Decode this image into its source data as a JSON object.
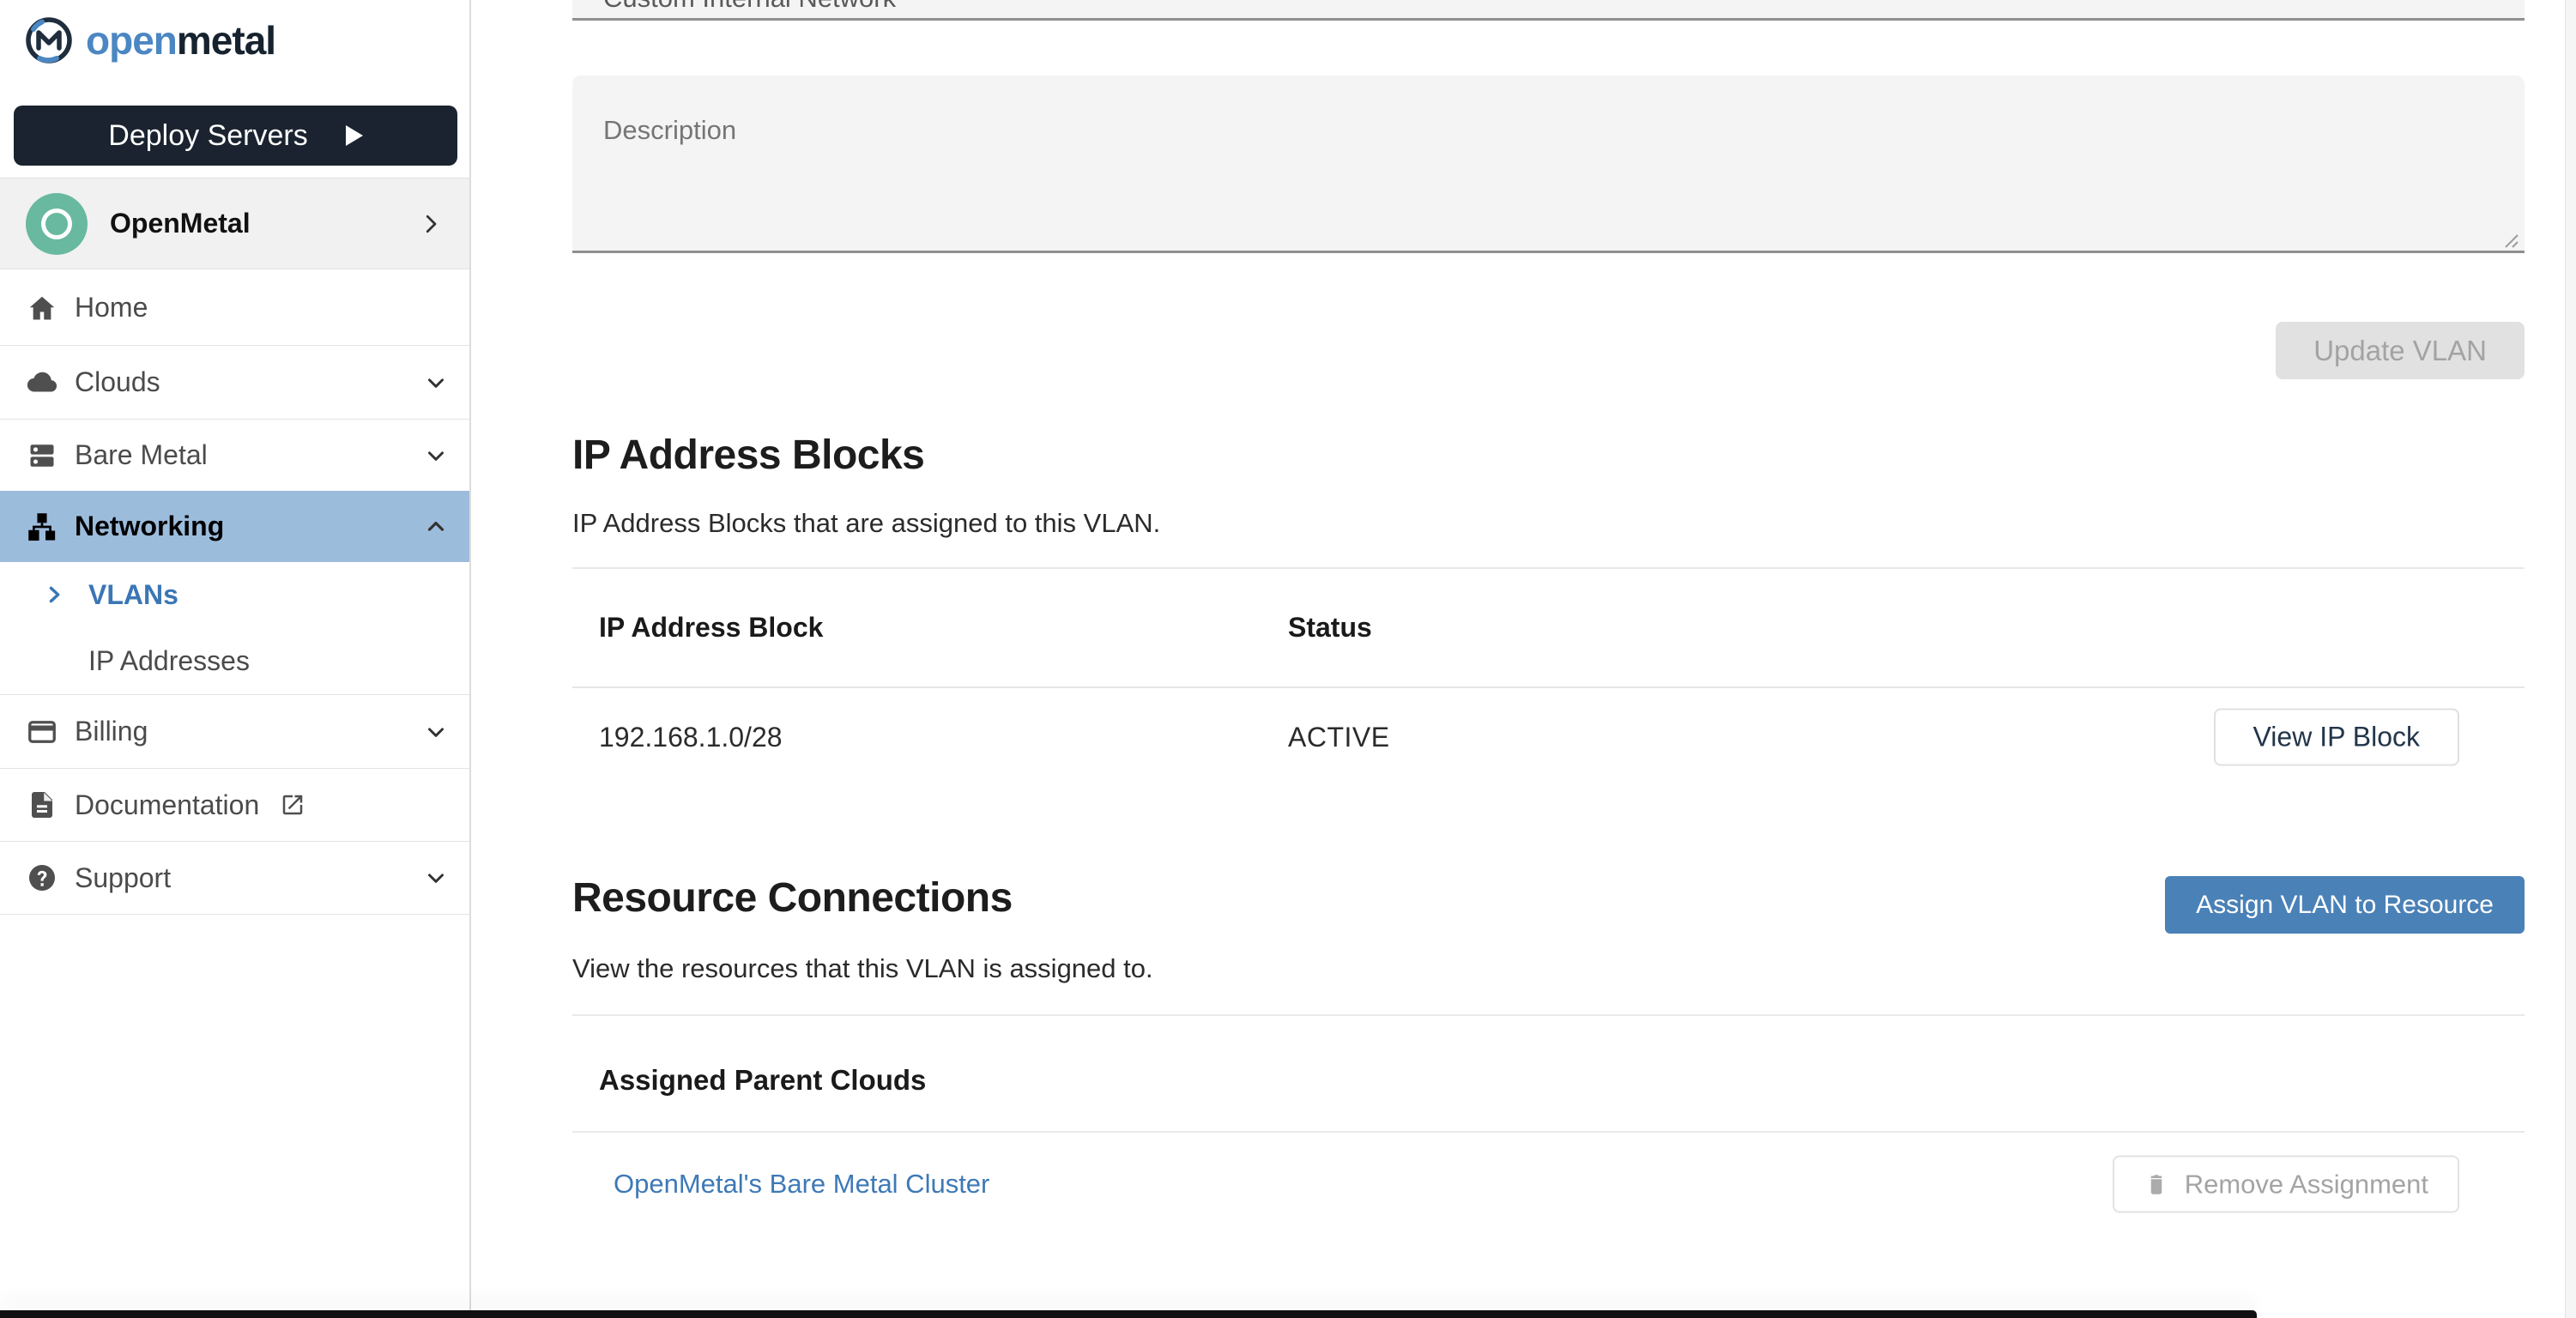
{
  "sidebar": {
    "logo": {
      "part1": "open",
      "part2": "metal"
    },
    "deploy_button": {
      "label": "Deploy Servers"
    },
    "account": {
      "name": "OpenMetal"
    },
    "nav": [
      {
        "label": "Home",
        "icon": "home-icon"
      },
      {
        "label": "Clouds",
        "icon": "cloud-icon",
        "chevron": "down"
      },
      {
        "label": "Bare Metal",
        "icon": "server-icon",
        "chevron": "down"
      },
      {
        "label": "Networking",
        "icon": "network-icon",
        "chevron": "up",
        "active": true
      },
      {
        "label": "VLANs",
        "sub": true,
        "active": true,
        "icon": "chevron-right-icon"
      },
      {
        "label": "IP Addresses",
        "sub": true
      },
      {
        "label": "Billing",
        "icon": "billing-card-icon",
        "chevron": "down"
      },
      {
        "label": "Documentation",
        "icon": "document-icon",
        "external": "external-link-icon"
      },
      {
        "label": "Support",
        "icon": "help-icon",
        "chevron": "down"
      }
    ]
  },
  "main": {
    "name_field": {
      "value": "Custom Internal Network"
    },
    "description_field": {
      "placeholder": "Description"
    },
    "update_button": "Update VLAN",
    "ip_blocks": {
      "title": "IP Address Blocks",
      "subtitle": "IP Address Blocks that are assigned to this VLAN.",
      "columns": [
        "IP Address Block",
        "Status"
      ],
      "rows": [
        {
          "block": "192.168.1.0/28",
          "status": "ACTIVE",
          "action": "View IP Block"
        }
      ]
    },
    "resource_connections": {
      "title": "Resource Connections",
      "subtitle": "View the resources that this VLAN is assigned to.",
      "assign_button": "Assign VLAN to Resource",
      "group_header": "Assigned Parent Clouds",
      "rows": [
        {
          "name": "OpenMetal's Bare Metal Cluster",
          "action": "Remove Assignment",
          "action_icon": "trash-icon"
        }
      ]
    }
  },
  "colors": {
    "brand_blue": "#4b87c2",
    "brand_dark": "#16232f",
    "nav_active_bg": "#9cbcdc",
    "link_blue": "#3b76b5",
    "primary_button_bg": "#4a81b7",
    "disabled_button_bg": "#e1e1e1",
    "avatar_teal": "#68b99f",
    "field_fill": "#f4f4f4",
    "field_underline": "#8f8f8f"
  }
}
